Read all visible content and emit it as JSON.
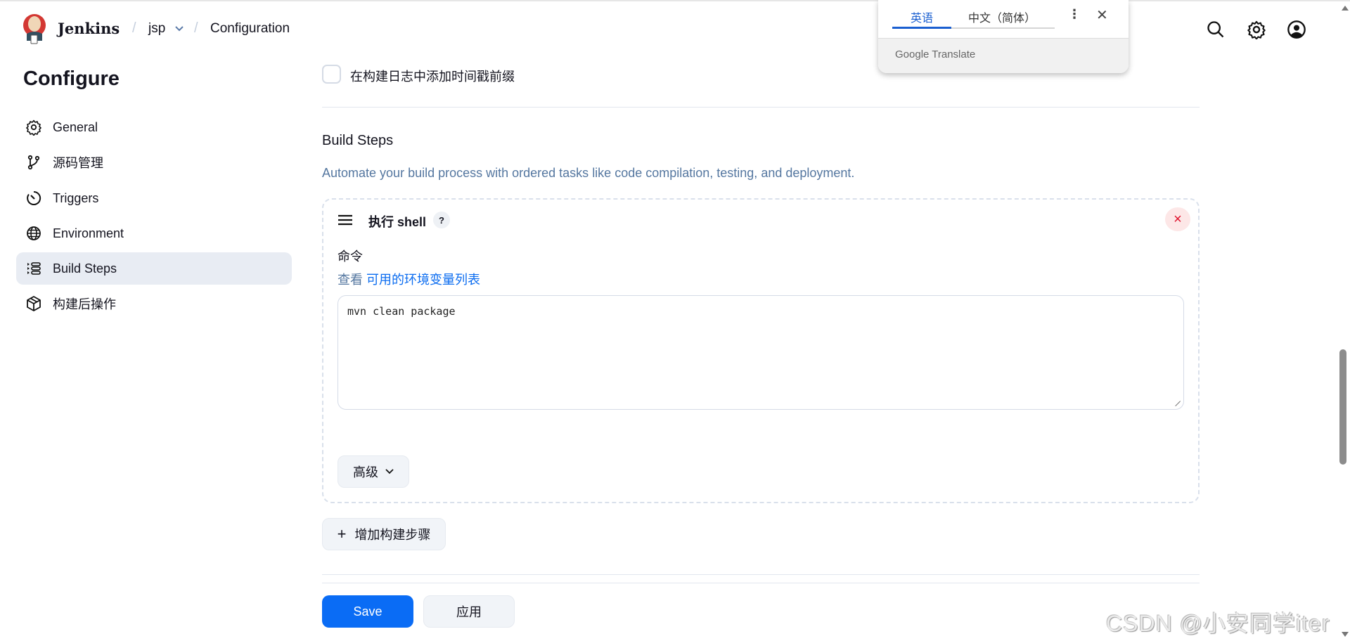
{
  "header": {
    "brand": "Jenkins",
    "crumbs": [
      {
        "label": "jsp"
      },
      {
        "label": "Configuration"
      }
    ],
    "separator": "/"
  },
  "translate": {
    "tabs": [
      "英语",
      "中文（简体）"
    ],
    "footer": "Google Translate"
  },
  "sidebar": {
    "title": "Configure",
    "items": [
      {
        "label": "General",
        "icon": "gear-icon"
      },
      {
        "label": "源码管理",
        "icon": "git-branch-icon"
      },
      {
        "label": "Triggers",
        "icon": "timer-icon"
      },
      {
        "label": "Environment",
        "icon": "globe-icon"
      },
      {
        "label": "Build Steps",
        "icon": "list-icon",
        "active": true
      },
      {
        "label": "构建后操作",
        "icon": "package-icon"
      }
    ]
  },
  "main": {
    "timestamp_checkbox": "在构建日志中添加时间戳前缀",
    "section_title": "Build Steps",
    "section_desc": "Automate your build process with ordered tasks like code compilation, testing, and deployment.",
    "step": {
      "title": "执行 shell",
      "help": "?",
      "delete": "×",
      "field_label": "命令",
      "link_prefix": "查看",
      "link_text": "可用的环境变量列表",
      "command": "mvn clean package",
      "advanced": "高级"
    },
    "add_step": "增加构建步骤",
    "save": "Save",
    "apply": "应用"
  },
  "watermark": "CSDN @小安同学iter",
  "colors": {
    "accent": "#0a6cf5",
    "danger": "#e0102b"
  }
}
